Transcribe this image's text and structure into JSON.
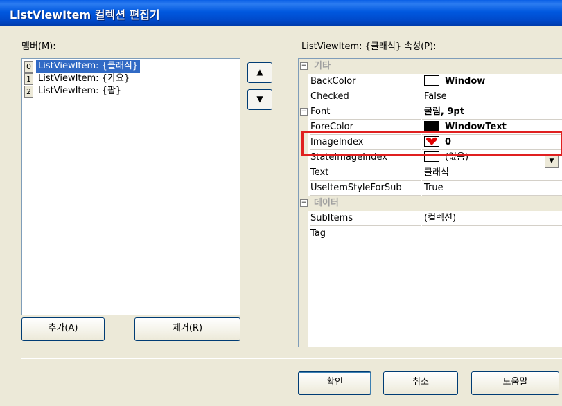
{
  "window": {
    "title": "ListViewItem 컬렉션 편집기"
  },
  "members": {
    "label": "멤버(M):",
    "items": [
      {
        "index": "0",
        "text": "ListViewItem: {클래식}"
      },
      {
        "index": "1",
        "text": "ListViewItem: {가요}"
      },
      {
        "index": "2",
        "text": "ListViewItem: {팝}"
      }
    ],
    "move_up_icon": "▲",
    "move_down_icon": "▼"
  },
  "buttons": {
    "add": "추가(A)",
    "remove": "제거(R)",
    "ok": "확인",
    "cancel": "취소",
    "help": "도움말"
  },
  "properties": {
    "label": "ListViewItem: {클래식} 속성(P):",
    "categories": {
      "misc": "기타",
      "data": "데이터"
    },
    "rows": {
      "backcolor": {
        "name": "BackColor",
        "value": "Window"
      },
      "checked": {
        "name": "Checked",
        "value": "False"
      },
      "font": {
        "name": "Font",
        "value": "굴림, 9pt"
      },
      "forecolor": {
        "name": "ForeColor",
        "value": "WindowText"
      },
      "imageindex": {
        "name": "ImageIndex",
        "value": "0"
      },
      "stateimageindex": {
        "name": "StateImageIndex",
        "value": "(없음)"
      },
      "text": {
        "name": "Text",
        "value": "클래식"
      },
      "useitemstyle": {
        "name": "UseItemStyleForSub",
        "value": "True"
      },
      "subitems": {
        "name": "SubItems",
        "value": "(컬렉션)"
      },
      "tag": {
        "name": "Tag",
        "value": ""
      }
    }
  },
  "colors": {
    "titlebar": "#0058df",
    "selection": "#316ac5",
    "highlight_box": "#e02020",
    "heart_icon": "#e00000"
  }
}
